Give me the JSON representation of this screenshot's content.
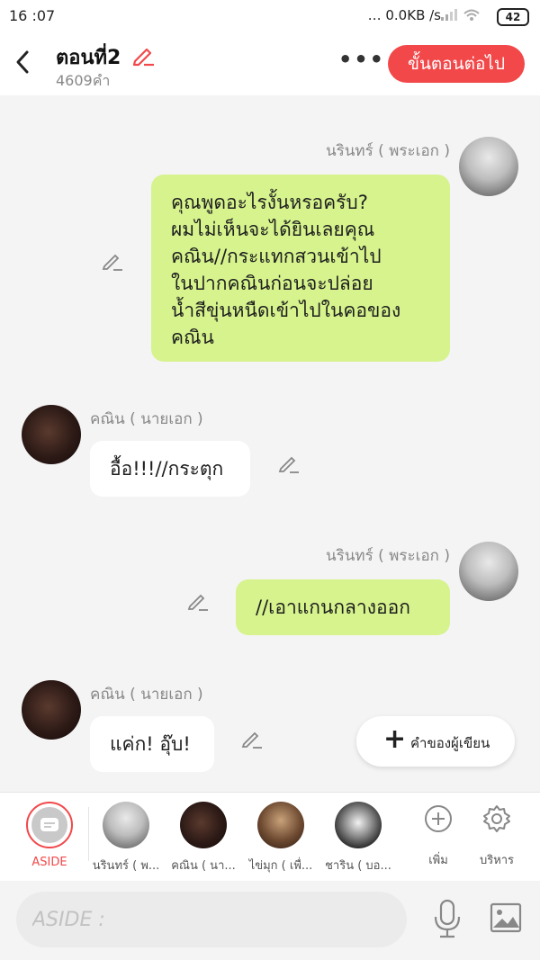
{
  "status_bar": {
    "time": "16 :07",
    "network_speed": "0.0KB /s",
    "battery": "42"
  },
  "header": {
    "title": "ตอนที่2",
    "word_count": "4609คำ",
    "more_label": "•••",
    "next_button": "ขั้นตอนต่อไป"
  },
  "messages": [
    {
      "sender": "นรินทร์ ( พระเอก )",
      "side": "right",
      "lines": [
        "คุณพูดอะไรงั้นหรอครับ?",
        "ผมไม่เห็นจะได้ยินเลยคุณ",
        "คณิน//กระแทกสวนเข้าไป",
        "ในปากคณินก่อนจะปล่อย",
        "น้ำสีขุ่นหนืดเข้าไปในคอของ",
        "คณิน"
      ]
    },
    {
      "sender": "คณิน ( นายเอก )",
      "side": "left",
      "lines": [
        "อื้อ!!!//กระตุก"
      ]
    },
    {
      "sender": "นรินทร์ ( พระเอก )",
      "side": "right",
      "lines": [
        "//เอาแกนกลางออก"
      ]
    },
    {
      "sender": "คณิน ( นายเอก )",
      "side": "left",
      "lines": [
        "แค่ก! อุ๊บ!"
      ]
    }
  ],
  "fab": {
    "icon": "plus-icon",
    "label": "คำของผู้เขียน"
  },
  "characters": [
    {
      "label": "ASIDE",
      "icon": "chat-bubble-icon",
      "selected": true
    },
    {
      "label": "นรินทร์ ( พ..."
    },
    {
      "label": "คณิน ( นา..."
    },
    {
      "label": "ไข่มุก ( เพื่..."
    },
    {
      "label": "ชาริน ( บอ..."
    }
  ],
  "tools": [
    {
      "label": "เพิ่ม",
      "icon": "add-circle-icon"
    },
    {
      "label": "บริหาร",
      "icon": "gear-icon"
    }
  ],
  "input": {
    "placeholder": "ASIDE :"
  },
  "colors": {
    "accent": "#f2484a",
    "bubble_right": "#d6f38d",
    "bubble_left": "#ffffff",
    "background": "#f4f4f4"
  }
}
